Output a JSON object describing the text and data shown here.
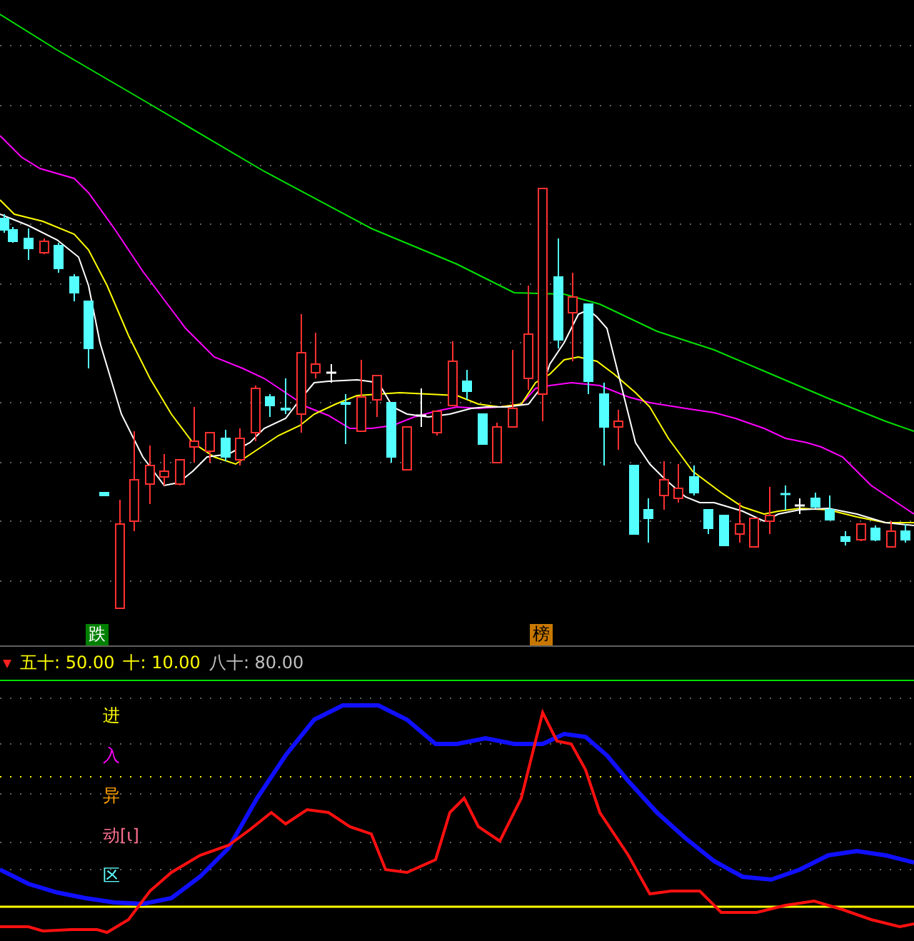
{
  "chart_badges": [
    {
      "label": "跌",
      "color": "#008000"
    },
    {
      "label": "榜",
      "color": "#c87800"
    }
  ],
  "legend": [
    {
      "label": "五十: 50.00",
      "color": "#ffff00"
    },
    {
      "label": "十: 10.00",
      "color": "#ffff00"
    },
    {
      "label": "八十: 80.00",
      "color": "#c0c0c0"
    }
  ],
  "indicator_labels": [
    {
      "label": "进",
      "color": "#ffff00"
    },
    {
      "label": "入",
      "color": "#ff00ff"
    },
    {
      "label": "异",
      "color": "#ffa000"
    },
    {
      "label": "动[ι]",
      "color": "#ff7090"
    },
    {
      "label": "区",
      "color": "#60ffff"
    }
  ]
}
